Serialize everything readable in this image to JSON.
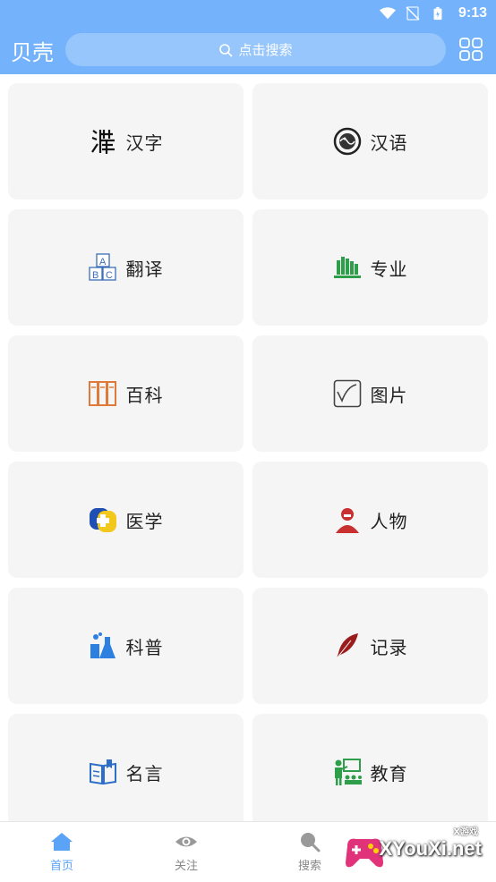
{
  "status_bar": {
    "time": "9:13"
  },
  "header": {
    "title": "贝壳",
    "search_placeholder": "点击搜索"
  },
  "cards": [
    {
      "label": "汉字",
      "icon": "hanzi-seal-icon"
    },
    {
      "label": "汉语",
      "icon": "dragon-emblem-icon"
    },
    {
      "label": "翻译",
      "icon": "abc-blocks-icon"
    },
    {
      "label": "专业",
      "icon": "books-shelf-icon"
    },
    {
      "label": "百科",
      "icon": "encyclopedia-books-icon"
    },
    {
      "label": "图片",
      "icon": "picture-frame-icon"
    },
    {
      "label": "医学",
      "icon": "medical-cross-icon"
    },
    {
      "label": "人物",
      "icon": "portrait-icon"
    },
    {
      "label": "科普",
      "icon": "lab-flask-icon"
    },
    {
      "label": "记录",
      "icon": "quill-feather-icon"
    },
    {
      "label": "名言",
      "icon": "open-book-icon"
    },
    {
      "label": "教育",
      "icon": "teacher-board-icon"
    }
  ],
  "nav": [
    {
      "label": "首页",
      "icon": "home-icon",
      "active": true
    },
    {
      "label": "关注",
      "icon": "eye-icon",
      "active": false
    },
    {
      "label": "搜索",
      "icon": "search-icon",
      "active": false
    }
  ],
  "watermark": {
    "brand": "XYouXi.net",
    "tag": "X游戏"
  },
  "colors": {
    "accent": "#74b3fb",
    "active_nav": "#5aa3f7",
    "card_bg": "#f5f5f5"
  }
}
